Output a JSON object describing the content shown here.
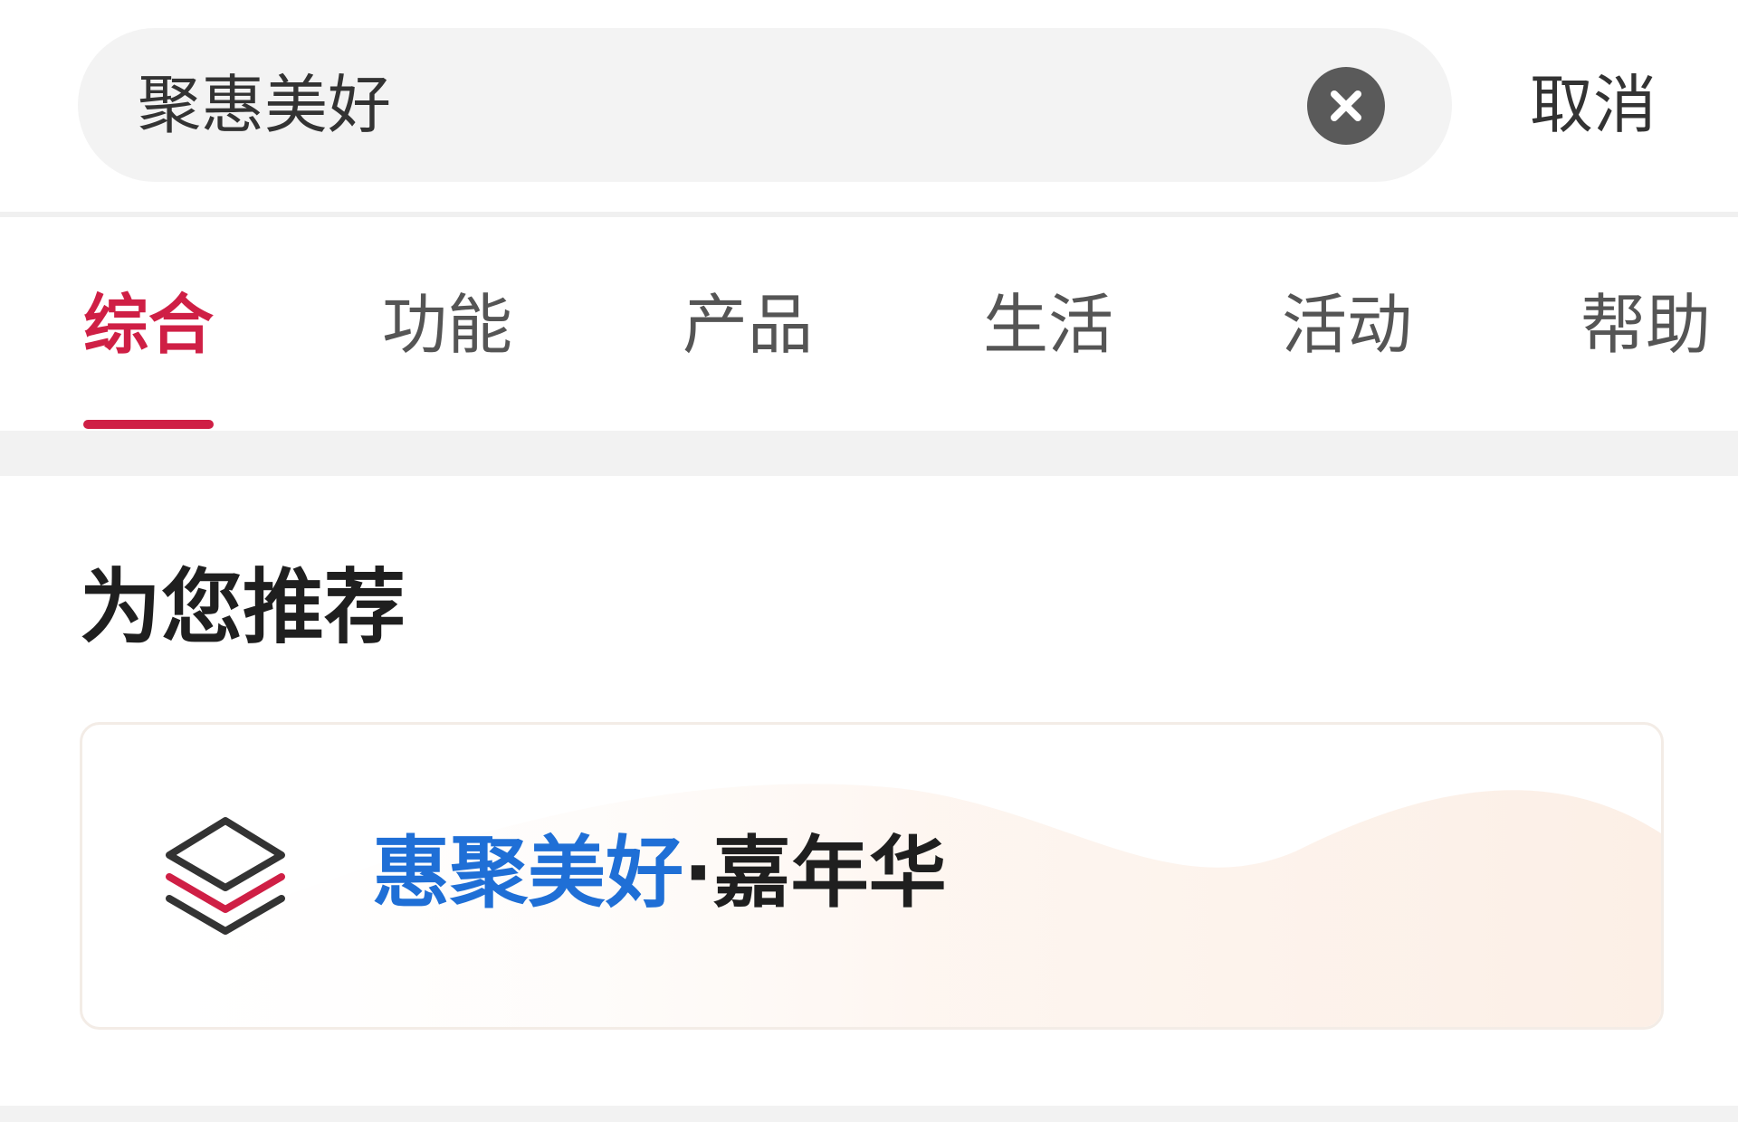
{
  "search": {
    "query": "聚惠美好",
    "clear_icon": "clear-icon",
    "cancel_label": "取消"
  },
  "tabs": [
    {
      "label": "综合",
      "active": true
    },
    {
      "label": "功能",
      "active": false
    },
    {
      "label": "产品",
      "active": false
    },
    {
      "label": "生活",
      "active": false
    },
    {
      "label": "活动",
      "active": false
    },
    {
      "label": "帮助",
      "active": false
    }
  ],
  "recommend": {
    "title": "为您推荐",
    "card": {
      "icon": "layers-icon",
      "highlight": "惠聚美好",
      "separator": "·",
      "rest": "嘉年华"
    }
  },
  "colors": {
    "accent": "#cf1f45",
    "highlight_blue": "#1f6fd6",
    "search_bg": "#f3f3f3"
  }
}
